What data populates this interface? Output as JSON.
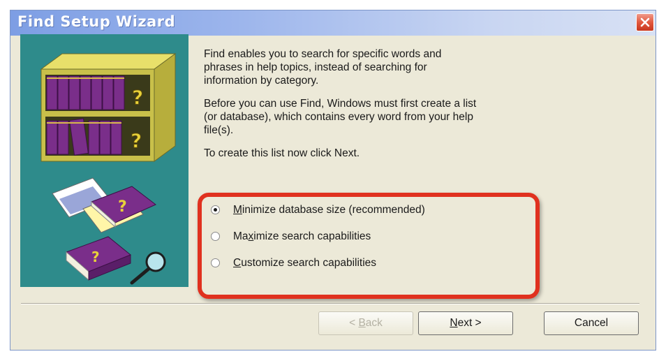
{
  "window": {
    "title": "Find Setup Wizard"
  },
  "content": {
    "paragraphs": [
      "Find enables you to search for specific words and\nphrases in help topics, instead of searching for\ninformation by category.",
      "Before you can use Find, Windows must first create a list\n(or database), which contains every word from your help\nfile(s).",
      "To create this list now click Next."
    ]
  },
  "options": [
    {
      "mnemonic": "M",
      "rest": "inimize database size (recommended)",
      "prefix": "",
      "checked": true
    },
    {
      "prefix": "Ma",
      "mnemonic": "x",
      "rest": "imize search capabilities",
      "checked": false
    },
    {
      "prefix": "",
      "mnemonic": "C",
      "rest": "ustomize search capabilities",
      "checked": false
    }
  ],
  "buttons": {
    "back_prefix": "< ",
    "back_mnemonic": "B",
    "back_rest": "ack",
    "next_mnemonic": "N",
    "next_rest": "ext >",
    "cancel": "Cancel"
  },
  "colors": {
    "highlight": "#e0311f",
    "art_background": "#2e8b8b",
    "book": "#7a2e8a"
  },
  "icons": [
    "close-icon",
    "bookshelf-icon",
    "book-question-icon",
    "magnifier-icon"
  ]
}
